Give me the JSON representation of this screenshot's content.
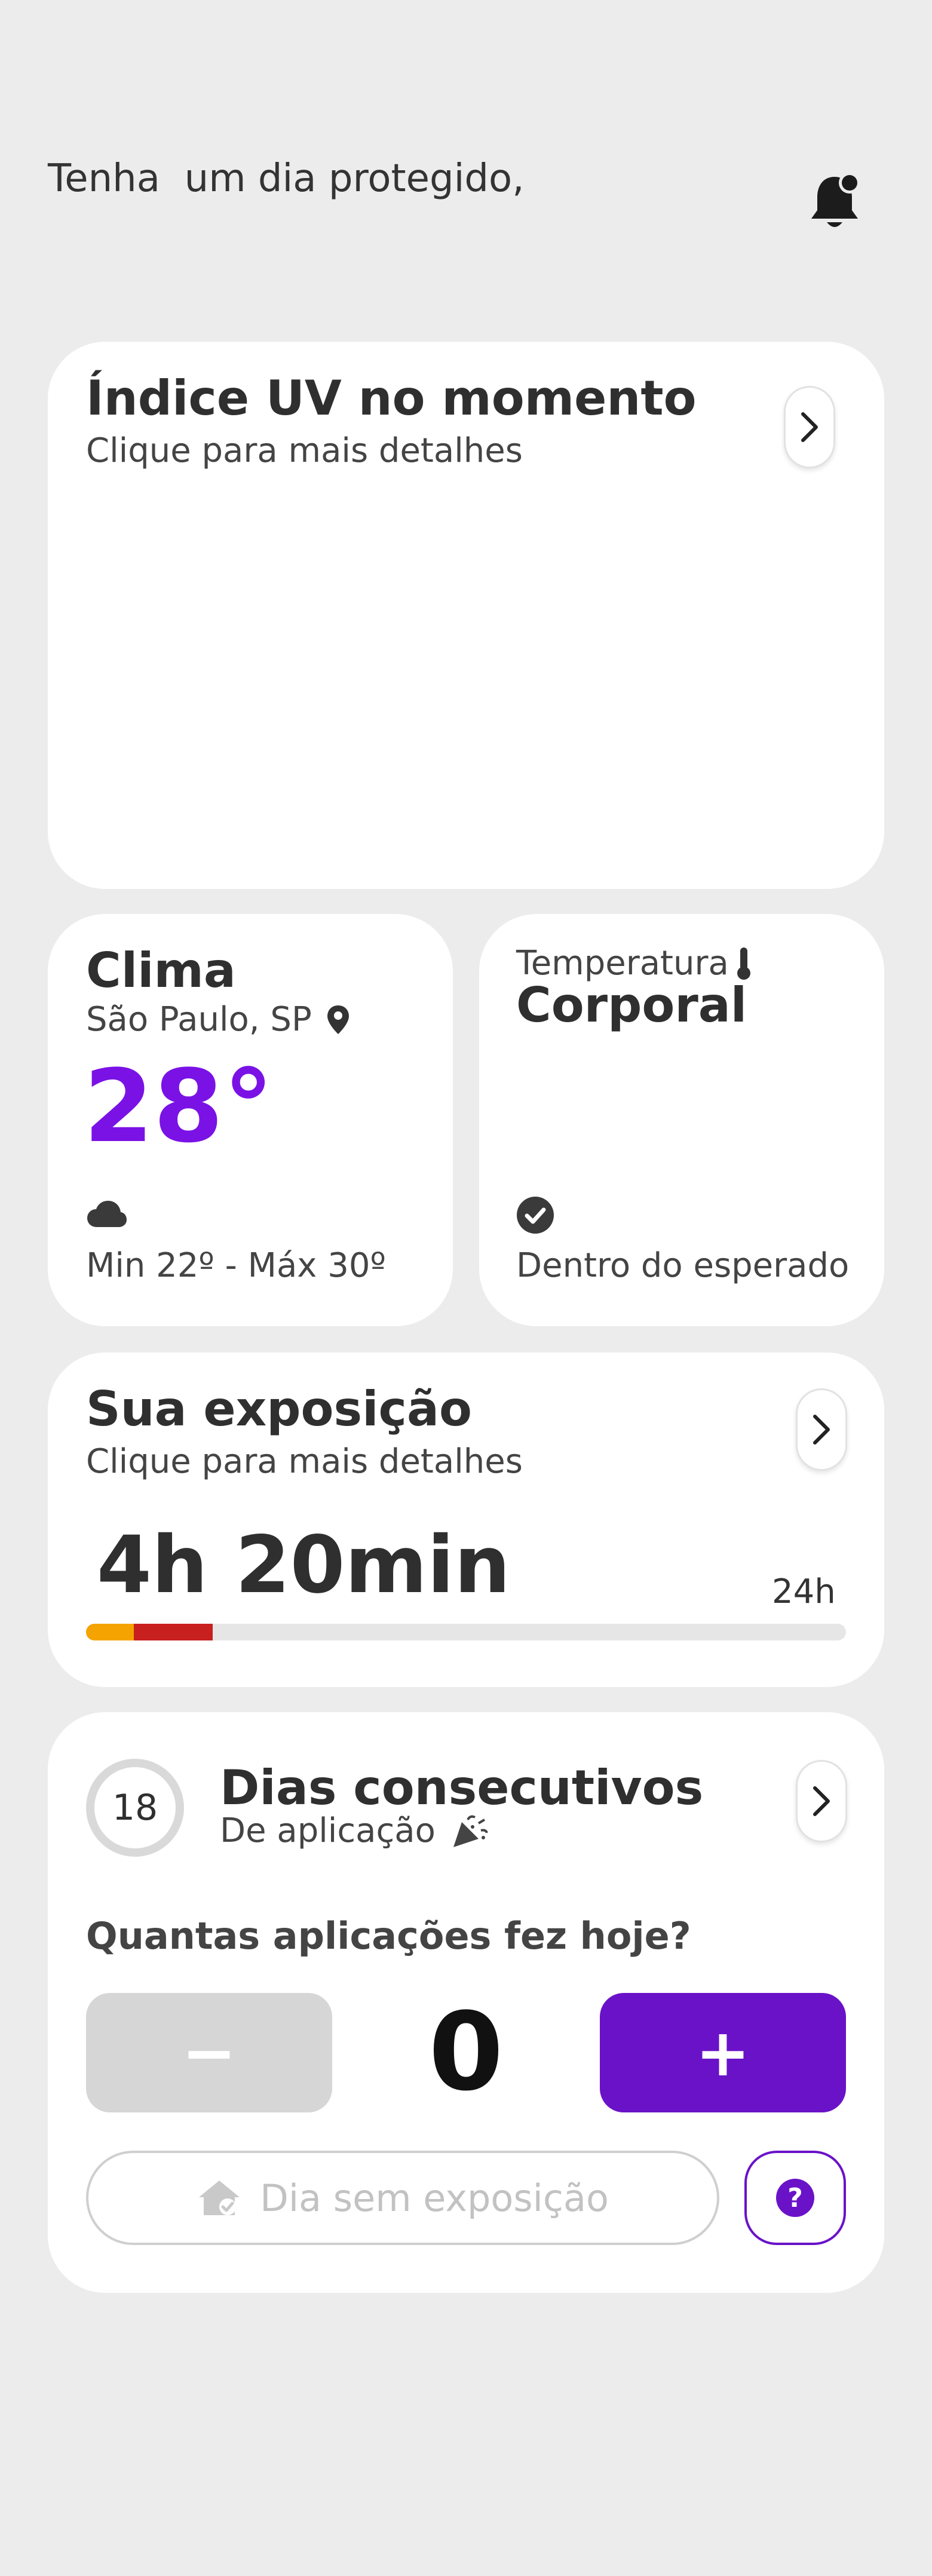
{
  "header": {
    "greeting": "Tenha  um dia protegido,",
    "notification_icon": "bell-icon"
  },
  "uv_card": {
    "title": "Índice UV no momento",
    "subtitle": "Clique para mais detalhes"
  },
  "weather_card": {
    "title": "Clima",
    "location": "São Paulo, SP",
    "temperature": "28°",
    "range": "Min 22º - Máx 30º",
    "accent_color": "#7a12e6"
  },
  "body_temp_card": {
    "label": "Temperatura",
    "title": "Corporal",
    "status": "Dentro do esperado"
  },
  "exposure_card": {
    "title": "Sua exposição",
    "subtitle": "Clique para mais detalhes",
    "time": "4h 20min",
    "max_label": "24h",
    "progress": {
      "orange_fraction": 0.0625,
      "red_fraction": 0.104
    },
    "colors": {
      "orange": "#f5a300",
      "red": "#c8201e",
      "track": "#e6e6e6"
    }
  },
  "streak_card": {
    "days": "18",
    "title": "Dias consecutivos",
    "subtitle": "De aplicação",
    "question": "Quantas aplicações fez hoje?",
    "count": "0",
    "minus_label": "−",
    "plus_label": "+",
    "no_exposure_label": "Dia sem exposição",
    "help_label": "?",
    "accent_color": "#6a12c8"
  }
}
